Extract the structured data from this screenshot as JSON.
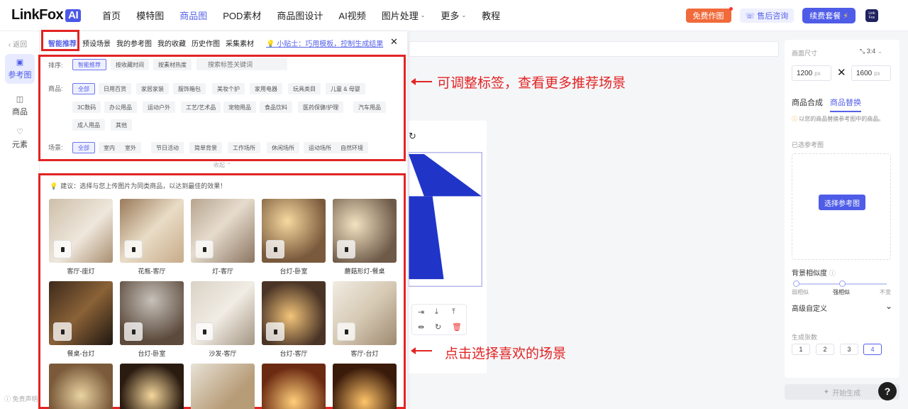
{
  "nav": {
    "brand": "LinkFox",
    "brand_ai": "AI",
    "links": [
      {
        "label": "首页"
      },
      {
        "label": "模特图"
      },
      {
        "label": "商品图",
        "active": true
      },
      {
        "label": "POD素材"
      },
      {
        "label": "商品图设计"
      },
      {
        "label": "AI视频"
      },
      {
        "label": "图片处理",
        "dropdown": true
      },
      {
        "label": "更多",
        "dropdown": true
      },
      {
        "label": "教程"
      }
    ],
    "free_btn": "免费作图",
    "support_btn": "售后咨询",
    "renew_btn": "续费套餐",
    "avatar_text": "Link Fox"
  },
  "leftbar": {
    "back": "返回",
    "items": [
      {
        "label": "参考图",
        "icon": "image-icon",
        "active": true
      },
      {
        "label": "商品",
        "icon": "lock-icon"
      },
      {
        "label": "元素",
        "icon": "heart-icon"
      }
    ],
    "disclaimer": "免责声明"
  },
  "popup": {
    "tabs": [
      "智能推荐",
      "预设场景",
      "我的参考图",
      "我的收藏",
      "历史作图",
      "采集素材"
    ],
    "tip": "小贴士：巧用模板，控制生成结果",
    "sort_label": "排序:",
    "sort_options": [
      "智能推荐",
      "按收藏时间",
      "按素材热度"
    ],
    "search_placeholder": "搜索标签关键词",
    "goods_label": "商品:",
    "goods_options": [
      "全部",
      "日用百货",
      "家居家装",
      "服饰箱包",
      "美妆个护",
      "家用电器",
      "玩具类目",
      "儿童 & 母婴",
      "3C数码",
      "办公用品",
      "运动户外",
      "工艺/艺术品",
      "宠物用品",
      "食品饮料",
      "医药保健/护理",
      "汽车用品",
      "成人用品",
      "其他"
    ],
    "scene_label": "场景:",
    "scene_options": [
      "全部",
      "室内",
      "室外",
      "节日活动",
      "简单背景",
      "工作场所",
      "休闲场所",
      "运动场所",
      "自然环境"
    ],
    "collapse": "收起",
    "suggestion": "建议：选择与您上传图片为同类商品，以达到最佳的效果！",
    "cards": [
      {
        "label": "客厅-座灯"
      },
      {
        "label": "花瓶-客厅"
      },
      {
        "label": "灯-客厅"
      },
      {
        "label": "台灯-卧室"
      },
      {
        "label": "蘑菇形灯-餐桌"
      },
      {
        "label": "餐桌-台灯"
      },
      {
        "label": "台灯-卧室"
      },
      {
        "label": "沙发-客厅"
      },
      {
        "label": "台灯-客厅"
      },
      {
        "label": "客厅-台灯"
      },
      {
        "label": ""
      },
      {
        "label": ""
      },
      {
        "label": ""
      },
      {
        "label": ""
      },
      {
        "label": ""
      }
    ]
  },
  "annotations": {
    "top": "可调整标签，查看更多推荐场景",
    "bottom": "点击选择喜欢的场景"
  },
  "right": {
    "size_title": "画面尺寸",
    "ratio": "3:4",
    "width": "1200",
    "height": "1600",
    "unit": "px",
    "tabs": [
      "商品合成",
      "商品替换"
    ],
    "desc": "以您的商品替换参考图中的商品。",
    "selected_ref": "已选参考图",
    "choose_ref": "选择参考图",
    "similarity_title": "背景相似度",
    "sim_labels": [
      "弱相似",
      "强相似",
      "不变"
    ],
    "advanced": "高级自定义",
    "count_title": "生成张数",
    "counts": [
      "1",
      "2",
      "3",
      "4"
    ],
    "generate": "开始生成"
  },
  "help": "?"
}
